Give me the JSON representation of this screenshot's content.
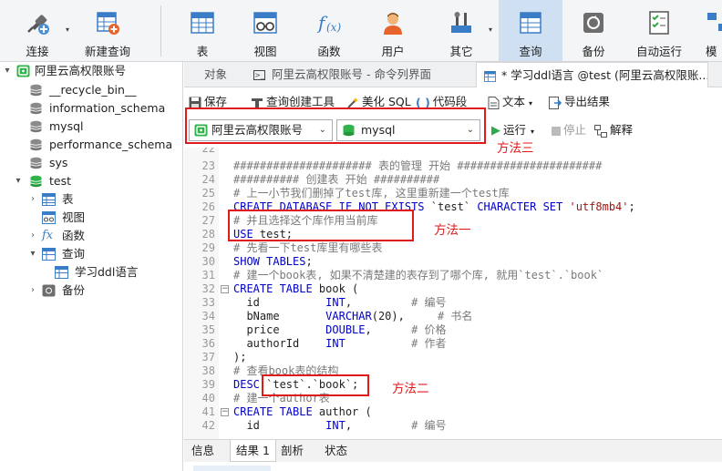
{
  "toolbar": {
    "items": [
      {
        "label": "连接",
        "icon": "plug-icon"
      },
      {
        "label": "新建查询",
        "icon": "new-query-icon"
      },
      {
        "label": "表",
        "icon": "table-icon"
      },
      {
        "label": "视图",
        "icon": "view-icon"
      },
      {
        "label": "函数",
        "icon": "function-icon"
      },
      {
        "label": "用户",
        "icon": "user-icon"
      },
      {
        "label": "其它",
        "icon": "tools-icon"
      },
      {
        "label": "查询",
        "icon": "query-icon"
      },
      {
        "label": "备份",
        "icon": "backup-icon"
      },
      {
        "label": "自动运行",
        "icon": "automation-icon"
      },
      {
        "label": "模",
        "icon": "model-icon"
      }
    ]
  },
  "sidebar": {
    "connection": "阿里云高权限账号",
    "databases": [
      "__recycle_bin__",
      "information_schema",
      "mysql",
      "performance_schema",
      "sys",
      "test"
    ],
    "test_children": {
      "tables": "表",
      "views": "视图",
      "functions": "函数",
      "queries": "查询",
      "query_item": "学习ddl语言",
      "backups": "备份"
    }
  },
  "tabs": {
    "objects": "对象",
    "console": "阿里云高权限账号 - 命令列界面",
    "query": "* 学习ddl语言 @test (阿里云高权限账..."
  },
  "query_toolbar": {
    "save": "保存",
    "builder": "查询创建工具",
    "beautify": "美化 SQL",
    "snippet": "代码段",
    "text": "文本",
    "export": "导出结果",
    "run": "运行",
    "stop": "停止",
    "explain": "解释",
    "connection_select": "阿里云高权限账号",
    "database_select": "mysql"
  },
  "annotations": {
    "method1": "方法一",
    "method2": "方法二",
    "method3": "方法三"
  },
  "code": {
    "line_numbers": [
      "22",
      "23",
      "24",
      "25",
      "26",
      "27",
      "28",
      "29",
      "30",
      "31",
      "32",
      "33",
      "34",
      "35",
      "36",
      "37",
      "38",
      "39",
      "40",
      "41",
      "42"
    ],
    "l23": "##################### 表的管理 开始 ######################",
    "l24": "########## 创建表 开始 ##########",
    "l25": "# 上一小节我们删掉了test库, 这里重新建一个test库",
    "l26_a": "CREATE DATABASE IF NOT EXISTS ",
    "l26_b": "`test` ",
    "l26_c": "CHARACTER SET ",
    "l26_d": "'utf8mb4'",
    "l26_e": ";",
    "l27": "# 并且选择这个库作用当前库",
    "l28_a": "USE ",
    "l28_b": "test;",
    "l29": "# 先看一下test库里有哪些表",
    "l30_a": "SHOW TABLES",
    "l30_b": ";",
    "l31": "# 建一个book表, 如果不清楚建的表存到了哪个库, 就用`test`.`book`",
    "l32_a": "CREATE TABLE ",
    "l32_b": "book (",
    "l33_a": "  id          ",
    "l33_b": "INT",
    "l33_c": ",         ",
    "l33_d": "# 编号",
    "l34_a": "  bName       ",
    "l34_b": "VARCHAR",
    "l34_c": "(20),     ",
    "l34_d": "# 书名",
    "l35_a": "  price       ",
    "l35_b": "DOUBLE",
    "l35_c": ",      ",
    "l35_d": "# 价格",
    "l36_a": "  authorId    ",
    "l36_b": "INT",
    "l36_c": "          ",
    "l36_d": "# 作者",
    "l37": ");",
    "l38": "# 查看book表的结构",
    "l39_a": "DESC ",
    "l39_b": "`test`.`book`;",
    "l40": "# 建一个author表",
    "l41_a": "CREATE TABLE ",
    "l41_b": "author (",
    "l42_a": "  id          ",
    "l42_b": "INT",
    "l42_c": ",         ",
    "l42_d": "# 编号"
  },
  "bottom_tabs": [
    "信息",
    "结果 1",
    "剖析",
    "状态"
  ]
}
